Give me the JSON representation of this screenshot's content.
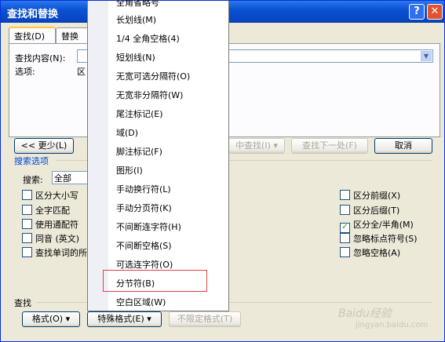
{
  "dialog": {
    "title": "查找和替换",
    "help_label": "?",
    "close_label": "✕"
  },
  "tabs": [
    {
      "label": "查找(D)",
      "active": true
    },
    {
      "label": "替换(P)",
      "active": false
    }
  ],
  "find": {
    "label": "查找内容(N):",
    "value": ""
  },
  "options": {
    "label": "选项:",
    "value": "区"
  },
  "buttons": {
    "less": "<< 更少(L)",
    "find_in": "中查找(I)",
    "find_next": "查找下一处(F)",
    "cancel": "取消"
  },
  "search_options": {
    "title": "搜索选项",
    "search_label": "搜索:",
    "search_value": "全部",
    "left": [
      {
        "label": "区分大小写",
        "checked": false
      },
      {
        "label": "全字匹配",
        "checked": false
      },
      {
        "label": "使用通配符",
        "checked": false
      },
      {
        "label": "同音 (英文)",
        "checked": false
      },
      {
        "label": "查找单词的所",
        "checked": false
      }
    ],
    "right": [
      {
        "label": "区分前缀(X)",
        "checked": false
      },
      {
        "label": "区分后缀(T)",
        "checked": false
      },
      {
        "label": "区分全/半角(M)",
        "checked": true
      },
      {
        "label": "忽略标点符号(S)",
        "checked": false
      },
      {
        "label": "忽略空格(A)",
        "checked": false
      }
    ]
  },
  "bottom": {
    "section": "查找",
    "format": "格式(O)",
    "special": "特殊格式(E)",
    "no_format": "不限定格式(T)"
  },
  "menu": {
    "items": [
      "全角省略号",
      "长划线(M)",
      "1/4 全角空格(4)",
      "短划线(N)",
      "无宽可选分隔符(O)",
      "无宽非分隔符(W)",
      "尾注标记(E)",
      "域(D)",
      "脚注标记(F)",
      "图形(I)",
      "手动换行符(L)",
      "手动分页符(K)",
      "不间断连字符(H)",
      "不间断空格(S)",
      "可选连字符(O)",
      "分节符(B)",
      "空白区域(W)"
    ],
    "highlighted_index": 15
  }
}
